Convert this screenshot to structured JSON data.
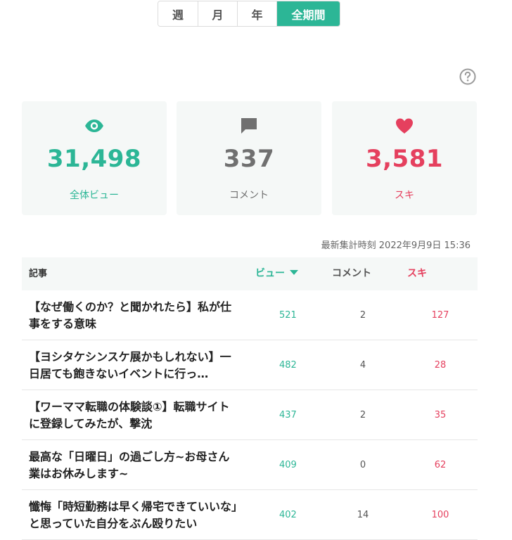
{
  "tabs": [
    {
      "label": "週"
    },
    {
      "label": "月"
    },
    {
      "label": "年"
    },
    {
      "label": "全期間",
      "active": true
    }
  ],
  "stats": {
    "views": {
      "value": "31,498",
      "label": "全体ビュー",
      "icon": "eye-icon",
      "color": "#2cb696"
    },
    "comments": {
      "value": "337",
      "label": "コメント",
      "icon": "comment-icon",
      "color": "#707070"
    },
    "likes": {
      "value": "3,581",
      "label": "スキ",
      "icon": "heart-icon",
      "color": "#e5405e"
    }
  },
  "updated": "最新集計時刻 2022年9月9日 15:36",
  "table": {
    "headers": {
      "article": "記事",
      "views": "ビュー",
      "comments": "コメント",
      "likes": "スキ"
    },
    "rows": [
      {
        "title": "【なぜ働くのか？と聞かれたら】私が仕事をする意味",
        "views": "521",
        "comments": "2",
        "likes": "127"
      },
      {
        "title": "【ヨシタケシンスケ展かもしれない】一日居ても飽きないイベントに行っ…",
        "views": "482",
        "comments": "4",
        "likes": "28"
      },
      {
        "title": "【ワーママ転職の体験談①】転職サイトに登録してみたが、撃沈",
        "views": "437",
        "comments": "2",
        "likes": "35"
      },
      {
        "title": "最高な「日曜日」の過ごし方~お母さん業はお休みします~",
        "views": "409",
        "comments": "0",
        "likes": "62"
      },
      {
        "title": "懺悔「時短勤務は早く帰宅できていいな」と思っていた自分をぶん殴りたい",
        "views": "402",
        "comments": "14",
        "likes": "100"
      }
    ]
  }
}
